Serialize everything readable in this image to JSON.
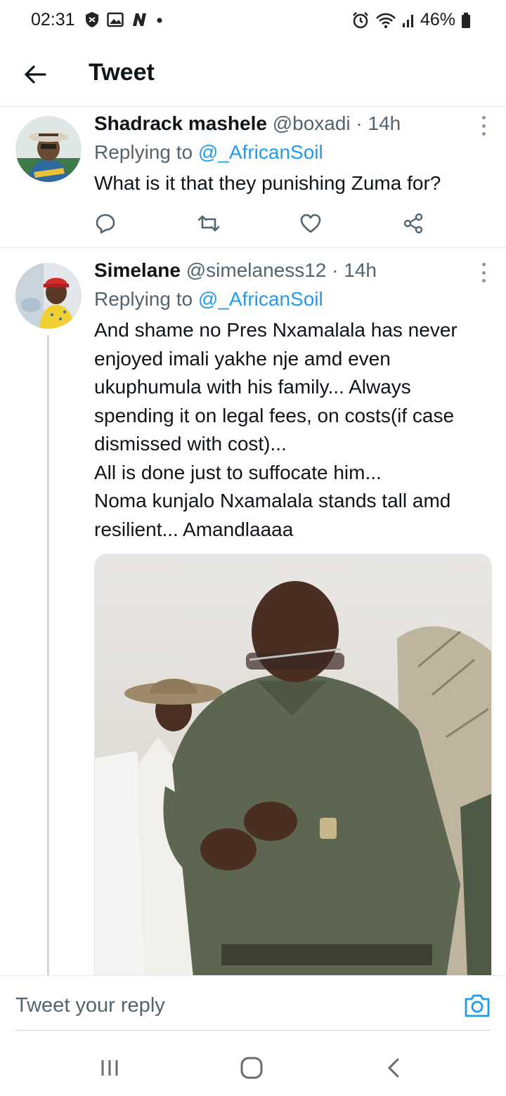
{
  "status_bar": {
    "time": "02:31",
    "battery": "46%",
    "icons": [
      "shield-icon",
      "image-icon",
      "n-app-icon",
      "dot-icon",
      "alarm-icon",
      "wifi-icon",
      "signal-icon",
      "battery-icon"
    ]
  },
  "header": {
    "title": "Tweet",
    "back_icon": "arrow-left-icon"
  },
  "tweets": [
    {
      "name": "Shadrack mashele",
      "handle": "@boxadi",
      "time": "14h",
      "replying_prefix": "Replying to",
      "replying_to": "@_AfricanSoil",
      "text": "What is it that they punishing Zuma for?",
      "actions": [
        "reply-icon",
        "retweet-icon",
        "like-icon",
        "share-icon"
      ]
    },
    {
      "name": "Simelane",
      "handle": "@simelaness12",
      "time": "14h",
      "replying_prefix": "Replying to",
      "replying_to": "@_AfricanSoil",
      "text": "And shame no Pres Nxamalala has never enjoyed imali yakhe nje amd even ukuphumula with his family... Always spending it on legal fees, on costs(if case dismissed with cost)...\nAll is done just to suffocate him...\nNoma kunjalo Nxamalala stands tall amd resilient... Amandlaaaa",
      "has_media": true
    }
  ],
  "separator": "·",
  "reply_bar": {
    "placeholder": "Tweet your reply",
    "icon": "camera-icon"
  },
  "nav_bar": {
    "icons": [
      "recent-apps-icon",
      "home-icon",
      "back-icon"
    ]
  },
  "colors": {
    "accent": "#1d9bf0",
    "secondary_text": "#536471",
    "primary_text": "#0f1419"
  }
}
